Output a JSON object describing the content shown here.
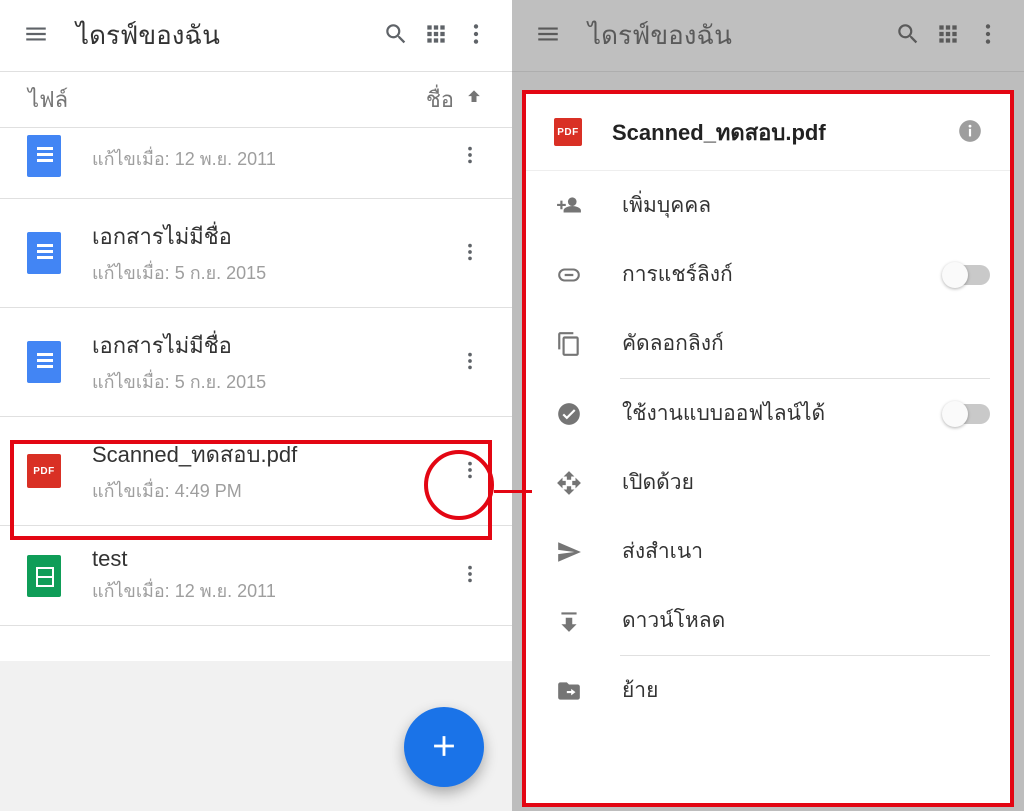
{
  "left": {
    "title": "ไดรฟ์ของฉัน",
    "tab_label": "ไฟล์",
    "sort_label": "ชื่อ",
    "files": [
      {
        "type": "doc",
        "name": "",
        "sub": "แก้ไขเมื่อ: 12 พ.ย. 2011"
      },
      {
        "type": "doc",
        "name": "เอกสารไม่มีชื่อ",
        "sub": "แก้ไขเมื่อ: 5 ก.ย. 2015"
      },
      {
        "type": "doc",
        "name": "เอกสารไม่มีชื่อ",
        "sub": "แก้ไขเมื่อ: 5 ก.ย. 2015"
      },
      {
        "type": "pdf",
        "name": "Scanned_ทดสอบ.pdf",
        "sub": "แก้ไขเมื่อ: 4:49 PM"
      },
      {
        "type": "sheet",
        "name": "test",
        "sub": "แก้ไขเมื่อ: 12 พ.ย. 2011"
      }
    ]
  },
  "right": {
    "title": "ไดรฟ์ของฉัน",
    "sheet_title": "Scanned_ทดสอบ.pdf",
    "items": {
      "add_people": "เพิ่มบุคคล",
      "link_sharing": "การแชร์ลิงก์",
      "copy_link": "คัดลอกลิงก์",
      "offline": "ใช้งานแบบออฟไลน์ได้",
      "open_with": "เปิดด้วย",
      "send_copy": "ส่งสำเนา",
      "download": "ดาวน์โหลด",
      "move": "ย้าย"
    }
  },
  "pdf_badge_text": "PDF"
}
